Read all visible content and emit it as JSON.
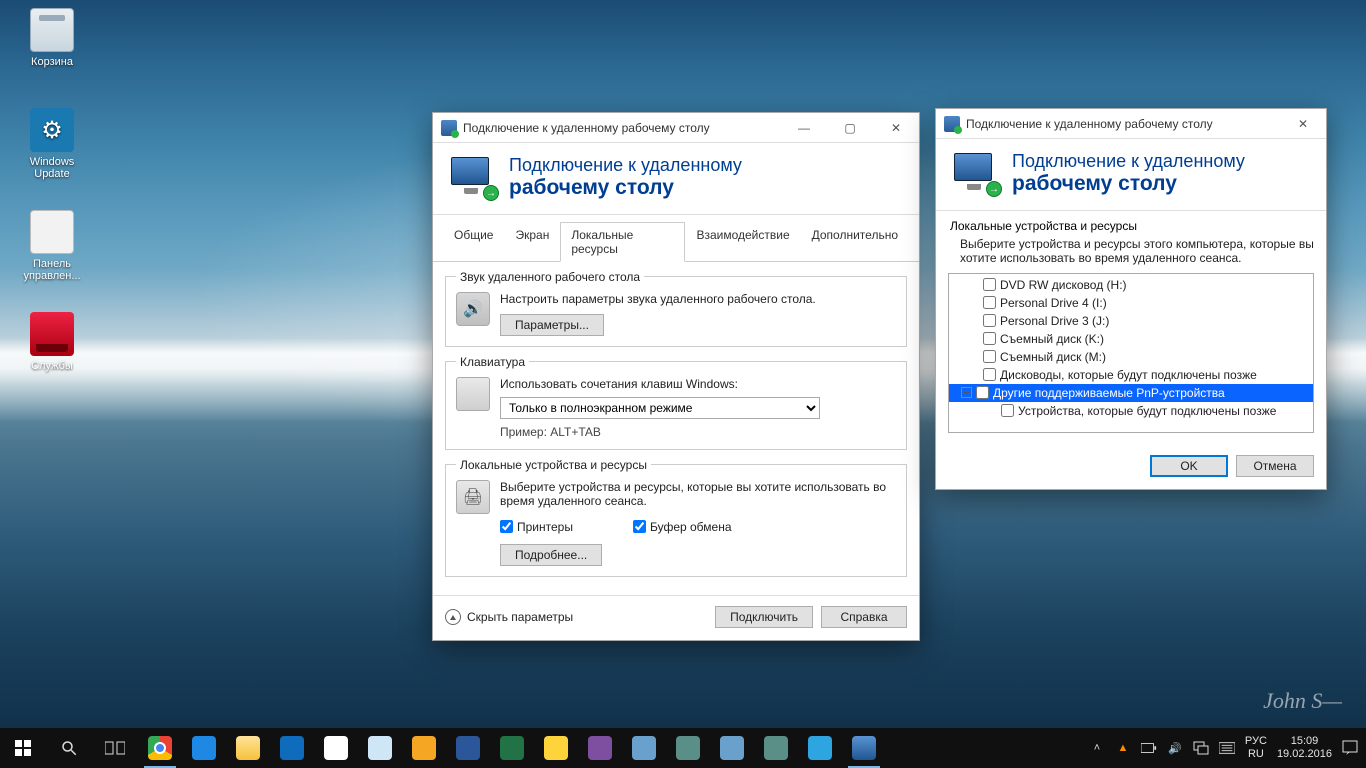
{
  "desktop": {
    "icons": {
      "recycle": "Корзина",
      "wupdate": "Windows Update",
      "cpanel": "Панель управлен...",
      "services": "Службы"
    }
  },
  "win1": {
    "title": "Подключение к удаленному рабочему столу",
    "banner_l1": "Подключение к удаленному",
    "banner_l2": "рабочему столу",
    "tabs": {
      "general": "Общие",
      "display": "Экран",
      "local": "Локальные ресурсы",
      "experience": "Взаимодействие",
      "advanced": "Дополнительно"
    },
    "grp_audio": {
      "legend": "Звук удаленного рабочего стола",
      "desc": "Настроить параметры звука удаленного рабочего стола.",
      "btn": "Параметры..."
    },
    "grp_kbd": {
      "legend": "Клавиатура",
      "desc": "Использовать сочетания клавиш Windows:",
      "combo": "Только в полноэкранном режиме",
      "hint": "Пример: ALT+TAB"
    },
    "grp_dev": {
      "legend": "Локальные устройства и ресурсы",
      "desc": "Выберите устройства и ресурсы, которые вы хотите использовать во время удаленного сеанса.",
      "printers": "Принтеры",
      "clipboard": "Буфер обмена",
      "btn": "Подробнее..."
    },
    "footer": {
      "hide": "Скрыть параметры",
      "connect": "Подключить",
      "help": "Справка"
    }
  },
  "win2": {
    "title": "Подключение к удаленному рабочему столу",
    "banner_l1": "Подключение к удаленному",
    "banner_l2": "рабочему столу",
    "legend": "Локальные устройства и ресурсы",
    "desc": "Выберите устройства и ресурсы этого компьютера, которые вы хотите использовать во время удаленного сеанса.",
    "tree": {
      "i0": "DVD RW дисковод (H:)",
      "i1": "Personal Drive 4 (I:)",
      "i2": "Personal Drive 3 (J:)",
      "i3": "Съемный диск (K:)",
      "i4": "Съемный диск (M:)",
      "i5": "Дисководы, которые будут подключены позже",
      "i6": "Другие поддерживаемые PnP-устройства",
      "i7": "Устройства, которые будут подключены позже"
    },
    "ok": "OK",
    "cancel": "Отмена"
  },
  "tray": {
    "lang1": "РУС",
    "lang2": "RU",
    "time": "15:09",
    "date": "19.02.2016"
  }
}
